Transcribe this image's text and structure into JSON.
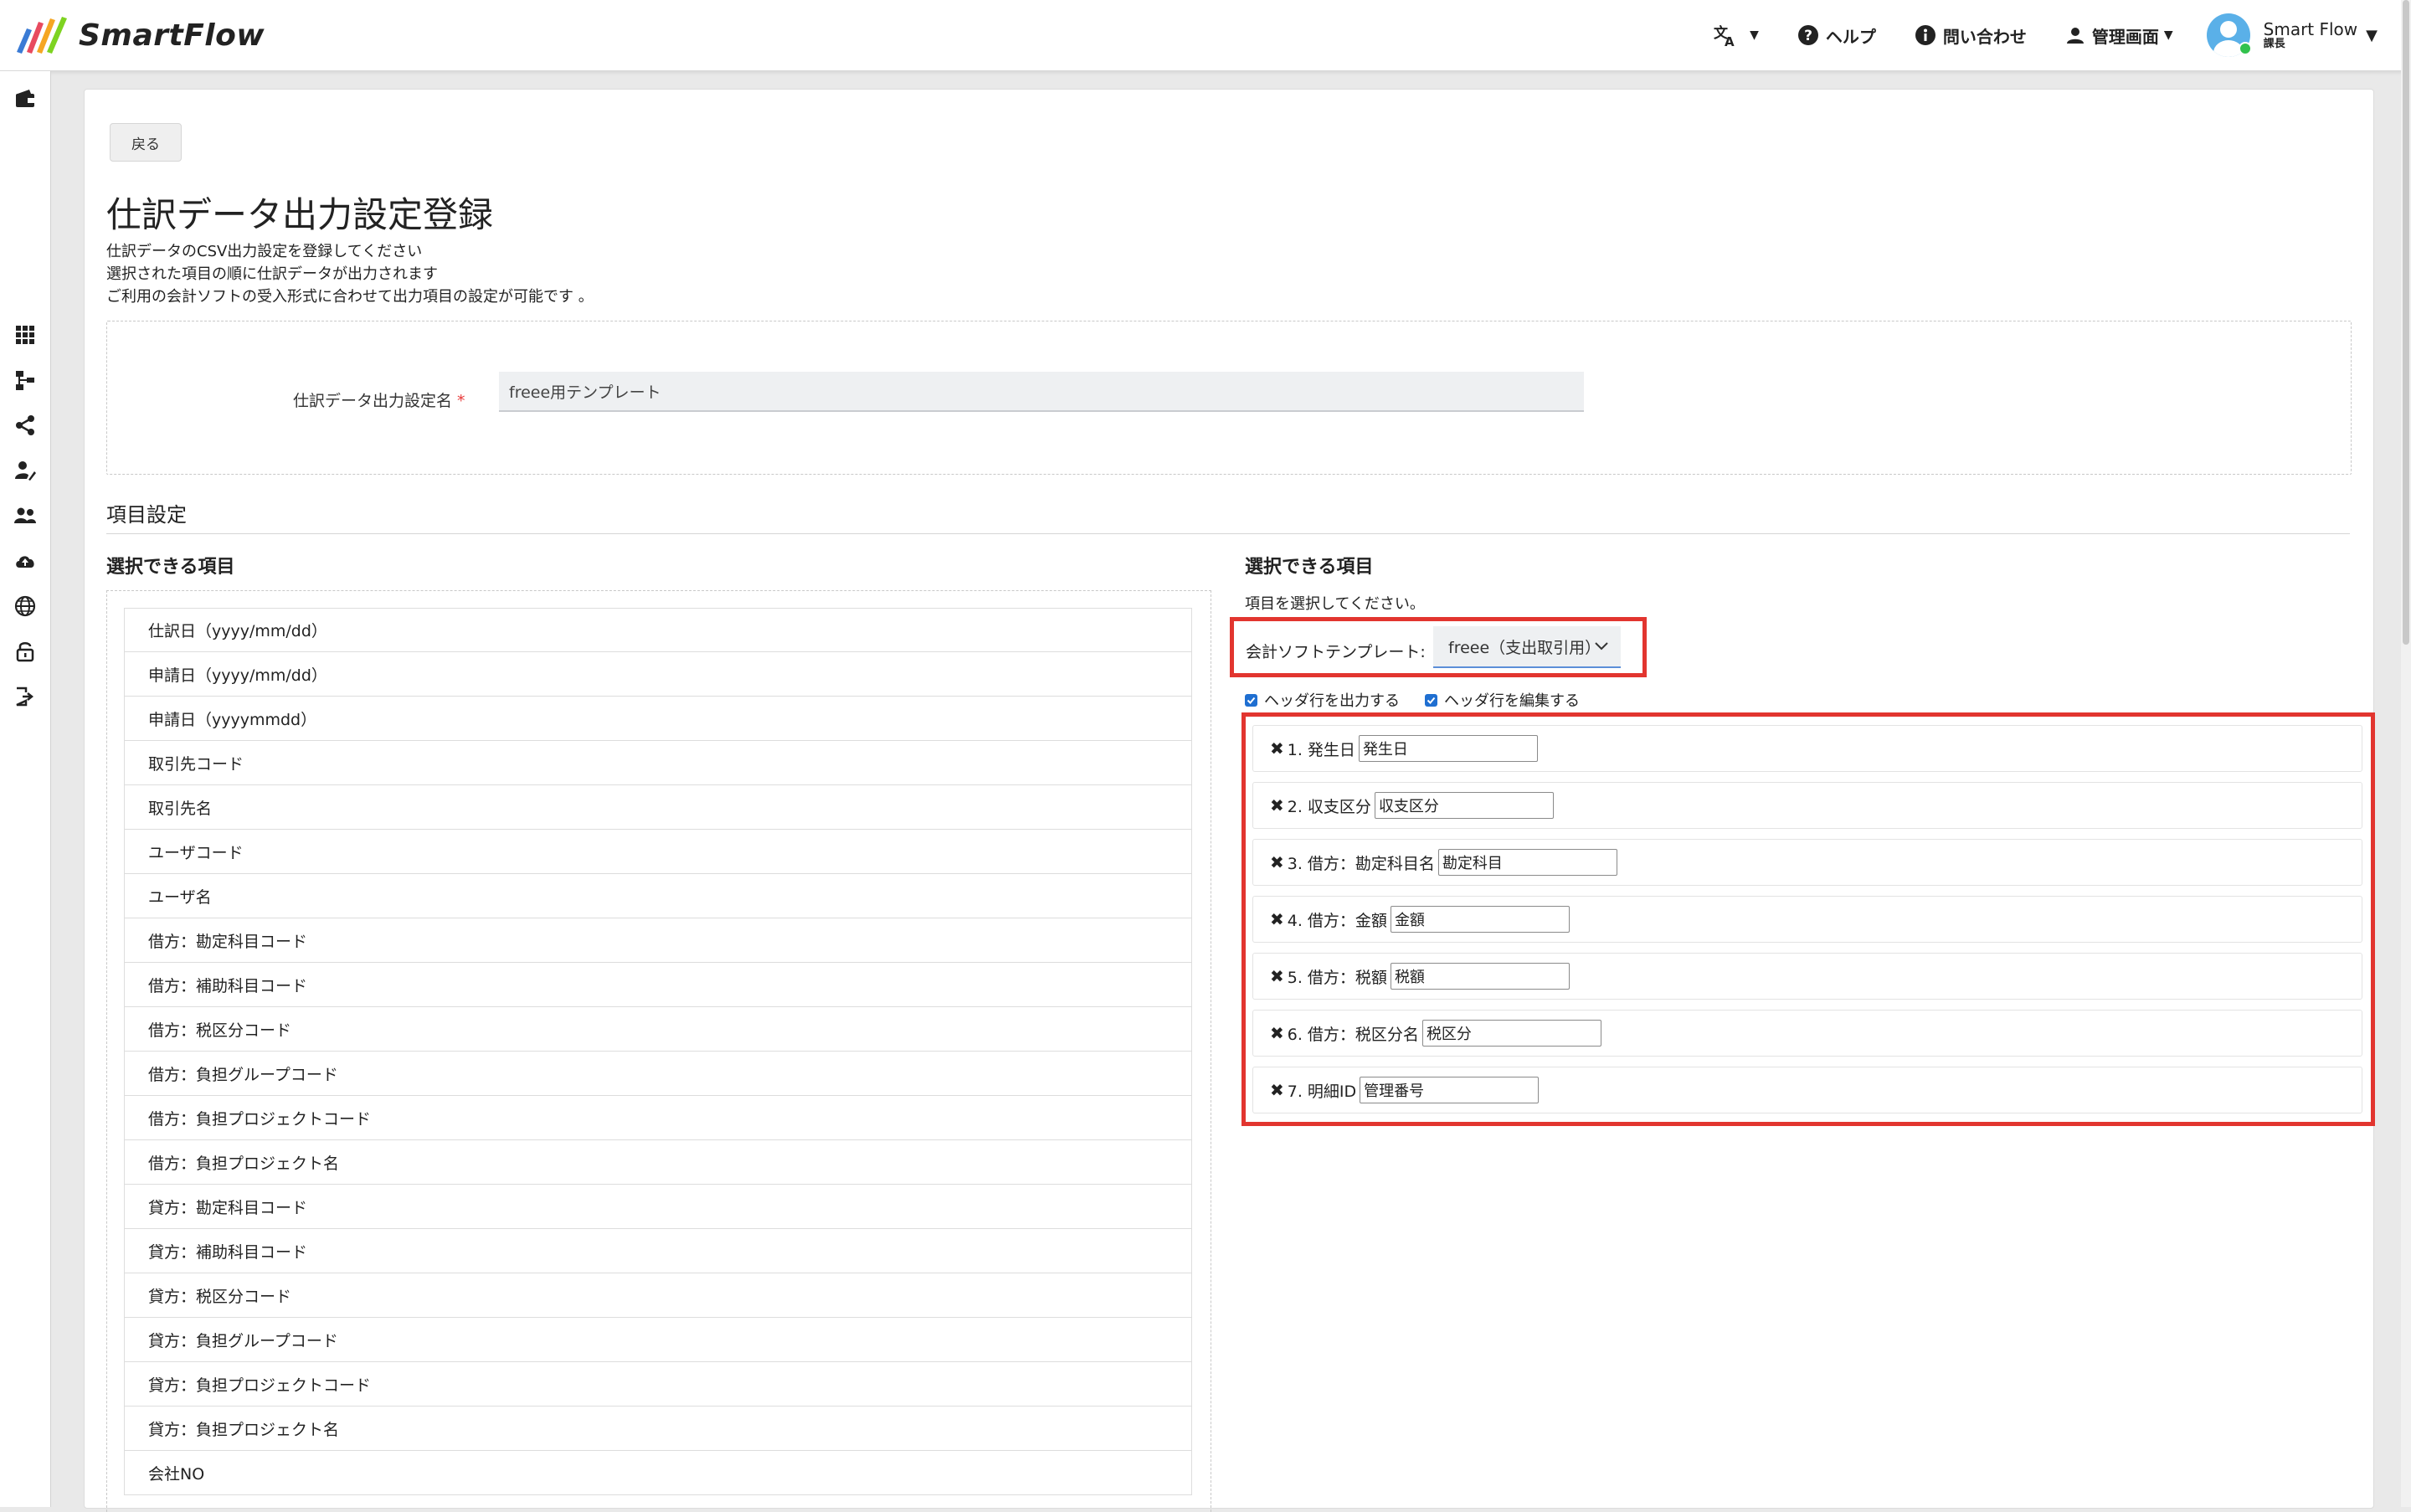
{
  "app": {
    "name": "SmartFlow"
  },
  "nav": {
    "language_icon": "translate-icon",
    "help": "ヘルプ",
    "contact": "問い合わせ",
    "admin": "管理画面",
    "user_name": "Smart Flow",
    "user_role": "課長"
  },
  "sidebar": {
    "icons": [
      "wallet-icon",
      "grid-icon",
      "flow-icon",
      "share-icon",
      "user-edit-icon",
      "users-icon",
      "cloud-upload-icon",
      "globe-icon",
      "lock-icon",
      "logout-icon"
    ]
  },
  "page": {
    "back_label": "戻る",
    "title": "仕訳データ出力設定登録",
    "desc": [
      "仕訳データのCSV出力設定を登録してください",
      "選択された項目の順に仕訳データが出力されます",
      "ご利用の会計ソフトの受入形式に合わせて出力項目の設定が可能です 。"
    ],
    "setting_name_label": "仕訳データ出力設定名",
    "required_mark": "*",
    "setting_name_value": "freee用テンプレート",
    "section_title": "項目設定"
  },
  "left": {
    "title": "選択できる項目",
    "items": [
      "仕訳日（yyyy/mm/dd）",
      "申請日（yyyy/mm/dd）",
      "申請日（yyyymmdd）",
      "取引先コード",
      "取引先名",
      "ユーザコード",
      "ユーザ名",
      "借方：勘定科目コード",
      "借方：補助科目コード",
      "借方：税区分コード",
      "借方：負担グループコード",
      "借方：負担プロジェクトコード",
      "借方：負担プロジェクト名",
      "貸方：勘定科目コード",
      "貸方：補助科目コード",
      "貸方：税区分コード",
      "貸方：負担グループコード",
      "貸方：負担プロジェクトコード",
      "貸方：負担プロジェクト名",
      "会社NO"
    ]
  },
  "right": {
    "title": "選択できる項目",
    "hint": "項目を選択してください。",
    "template_label": "会計ソフトテンプレート:",
    "template_value": "freee（支出取引用）",
    "check_output_header": "ヘッダ行を出力する",
    "check_edit_header": "ヘッダ行を編集する",
    "remove_symbol": "✖",
    "fields": [
      {
        "label": "1. 発生日",
        "value": "発生日"
      },
      {
        "label": "2. 収支区分",
        "value": "収支区分"
      },
      {
        "label": "3. 借方：勘定科目名",
        "value": "勘定科目"
      },
      {
        "label": "4. 借方：金額",
        "value": "金額"
      },
      {
        "label": "5. 借方：税額",
        "value": "税額"
      },
      {
        "label": "6. 借方：税区分名",
        "value": "税区分"
      },
      {
        "label": "7. 明細ID",
        "value": "管理番号"
      }
    ]
  },
  "colors": {
    "highlight": "#e2352f",
    "accent": "#1f6fd1"
  }
}
